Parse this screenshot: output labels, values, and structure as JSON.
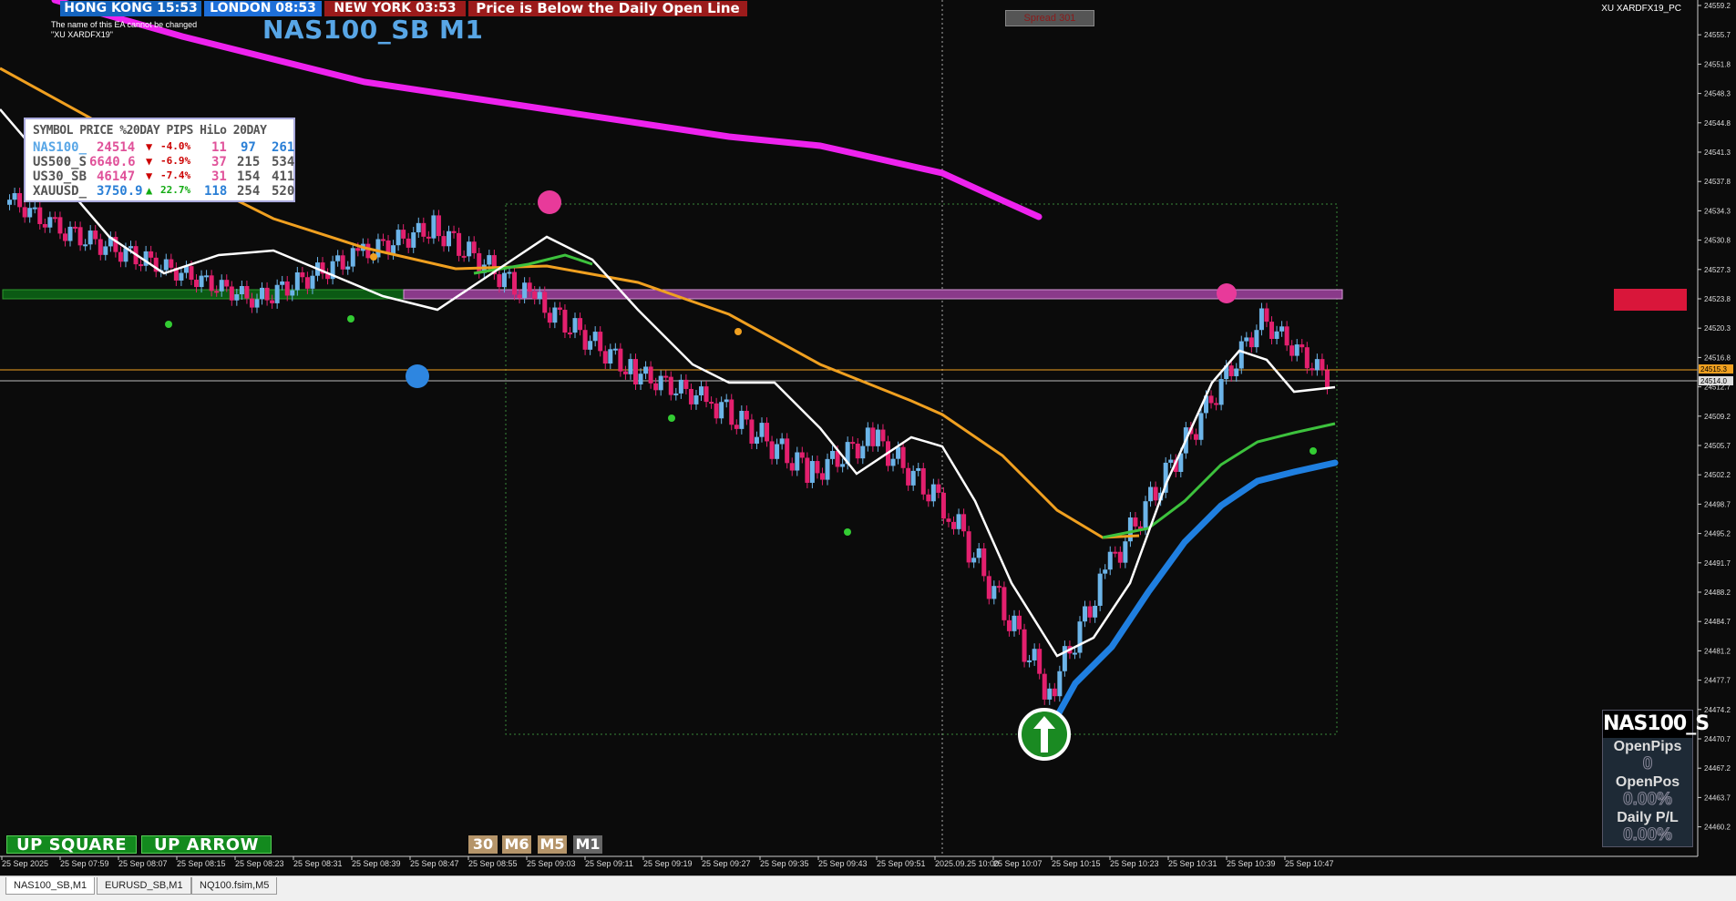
{
  "sessions": [
    {
      "label": "HONG KONG 15:53",
      "bg": "#1565c0"
    },
    {
      "label": "LONDON  08:53",
      "bg": "#1e6fd9"
    },
    {
      "label": "NEW YORK  03:53",
      "bg": "#9b1b1b"
    }
  ],
  "alert": {
    "text": "Price is Below the Daily Open Line",
    "bg": "#9b1b1b"
  },
  "ea_note": {
    "line1": "The name of this EA cannot be changed",
    "line2": "\"XU XARDFX19\""
  },
  "symbol_title": "NAS100_SB M1",
  "top_right_label": "XU XARDFX19_PC",
  "indicator_box": "Spread 301",
  "stats_table": {
    "header": "SYMBOL PRICE %20DAY PIPS HiLo 20DAY",
    "rows": [
      {
        "symbol": "NAS100_",
        "price": "24514",
        "dir": "down",
        "pct": "-4.0%",
        "pips": "11",
        "hilo": "97",
        "day20": "261"
      },
      {
        "symbol": "US500_S",
        "price": "6640.6",
        "dir": "down",
        "pct": "-6.9%",
        "pips": "37",
        "hilo": "215",
        "day20": "534"
      },
      {
        "symbol": "US30_SB",
        "price": "46147",
        "dir": "down",
        "pct": "-7.4%",
        "pips": "31",
        "hilo": "154",
        "day20": "411"
      },
      {
        "symbol": "XAUUSD_",
        "price": "3750.9",
        "dir": "up",
        "pct": "22.7%",
        "pips": "118",
        "hilo": "254",
        "day20": "520"
      }
    ]
  },
  "buttons": {
    "up_square": "UP SQUARE",
    "up_arrow": "UP ARROW"
  },
  "timeframes": [
    "30",
    "M6",
    "M5",
    "M1"
  ],
  "pips_panel": {
    "title": "NAS100_S",
    "open_pips_label": "OpenPips",
    "open_pips_value": "0",
    "open_pos_label": "OpenPos",
    "open_pos_value": "0.00%",
    "daily_pl_label": "Daily P/L",
    "daily_pl_value": "0.00%"
  },
  "price_axis": {
    "labels": [
      "24559.2",
      "24555.7",
      "24551.8",
      "24548.3",
      "24544.8",
      "24541.3",
      "24537.8",
      "24534.3",
      "24530.8",
      "24527.3",
      "24523.8",
      "24520.3",
      "24516.8",
      "24512.7",
      "24509.2",
      "24505.7",
      "24502.2",
      "24498.7",
      "24495.2",
      "24491.7",
      "24488.2",
      "24484.7",
      "24481.2",
      "24477.7",
      "24474.2",
      "24470.7",
      "24467.2",
      "24463.7",
      "24460.2"
    ],
    "current_price": "24515.3",
    "bid_price": "24514.0"
  },
  "time_axis": [
    "25 Sep 2025",
    "25 Sep 07:59",
    "25 Sep 08:07",
    "25 Sep 08:15",
    "25 Sep 08:23",
    "25 Sep 08:31",
    "25 Sep 08:39",
    "25 Sep 08:47",
    "25 Sep 08:55",
    "25 Sep 09:03",
    "25 Sep 09:11",
    "25 Sep 09:19",
    "25 Sep 09:27",
    "25 Sep 09:35",
    "25 Sep 09:43",
    "25 Sep 09:51",
    "2025.09.25 10:00",
    "25 Sep 10:07",
    "25 Sep 10:15",
    "25 Sep 10:23",
    "25 Sep 10:31",
    "25 Sep 10:39",
    "25 Sep 10:47"
  ],
  "tabs": [
    "NAS100_SB,M1",
    "EURUSD_SB,M1",
    "NQ100.fsim,M5"
  ],
  "colors": {
    "bull": "#6cb4e8",
    "bear": "#e3206e",
    "neutral": "#555555",
    "ema_fast": "#ffffff",
    "ema_orange": "#f0a020",
    "ema_green": "#3dc23d",
    "ema_blue": "#1f7fe0",
    "ema_magenta": "#ee22ee"
  }
}
